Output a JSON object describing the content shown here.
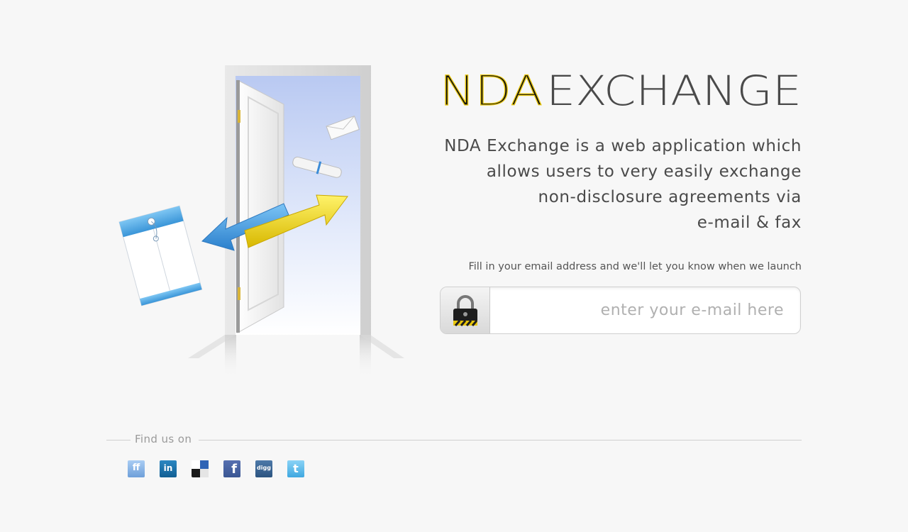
{
  "logo": {
    "part1": "NDA",
    "part2": "EXCHANGE"
  },
  "tagline": [
    "NDA Exchange is a web application which",
    "allows users to very easily exchange",
    "non-disclosure agreements via",
    "e-mail & fax"
  ],
  "signup": {
    "prompt": "Fill in your email address and we'll let you know when we launch",
    "placeholder": "enter your e-mail here",
    "value": ""
  },
  "findus": {
    "label": "Find us on"
  },
  "social": [
    {
      "name": "friendfeed-icon",
      "glyph": "ff"
    },
    {
      "name": "linkedin-icon",
      "glyph": "in"
    },
    {
      "name": "delicious-icon",
      "glyph": ""
    },
    {
      "name": "facebook-icon",
      "glyph": "f"
    },
    {
      "name": "digg-icon",
      "glyph": "digg"
    },
    {
      "name": "twitter-icon",
      "glyph": "t"
    }
  ],
  "colors": {
    "background": "#f7f7f7",
    "logo_yellow": "#e8c60c",
    "logo_black": "#111111",
    "logo_gray": "#4a4a4a",
    "text": "#4a4a4a",
    "arrow_blue": "#3d9be0",
    "arrow_yellow": "#e8d40f"
  }
}
